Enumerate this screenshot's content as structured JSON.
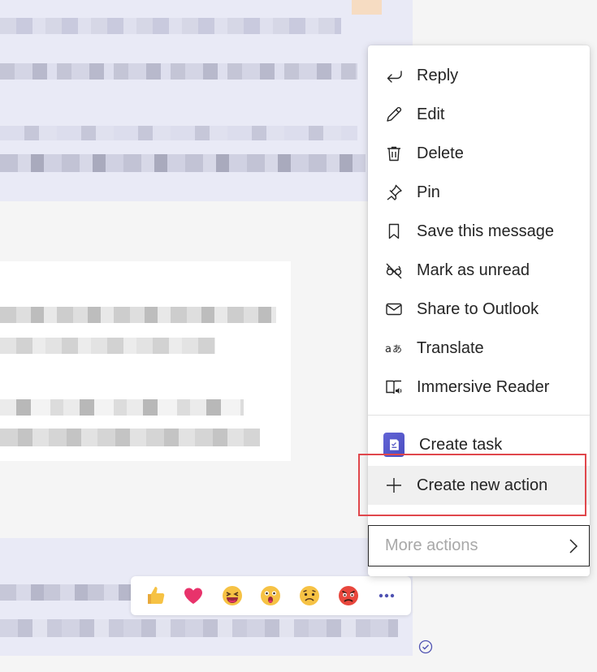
{
  "menu": {
    "items": [
      {
        "label": "Reply",
        "icon": "reply-icon"
      },
      {
        "label": "Edit",
        "icon": "pencil-icon"
      },
      {
        "label": "Delete",
        "icon": "trash-icon"
      },
      {
        "label": "Pin",
        "icon": "pin-icon"
      },
      {
        "label": "Save this message",
        "icon": "bookmark-icon"
      },
      {
        "label": "Mark as unread",
        "icon": "glasses-off-icon"
      },
      {
        "label": "Share to Outlook",
        "icon": "mail-icon"
      },
      {
        "label": "Translate",
        "icon": "translate-icon"
      },
      {
        "label": "Immersive Reader",
        "icon": "immersive-reader-icon"
      }
    ],
    "apps": [
      {
        "label": "Create task",
        "icon": "tasks-app-icon"
      },
      {
        "label": "Create new action",
        "icon": "plus-icon"
      }
    ],
    "more_actions": {
      "label": "More actions",
      "icon": "chevron-right-icon"
    }
  },
  "reactions": [
    {
      "name": "like",
      "icon": "thumbs-up-icon"
    },
    {
      "name": "heart",
      "icon": "heart-icon"
    },
    {
      "name": "laugh",
      "icon": "laughing-face-icon"
    },
    {
      "name": "surprised",
      "icon": "surprised-face-icon"
    },
    {
      "name": "sad",
      "icon": "sad-face-icon"
    },
    {
      "name": "angry",
      "icon": "angry-face-icon"
    }
  ],
  "colors": {
    "accent": "#4f52b2",
    "highlight_border": "#e0474c",
    "message_bg": "#e9eaf6"
  }
}
